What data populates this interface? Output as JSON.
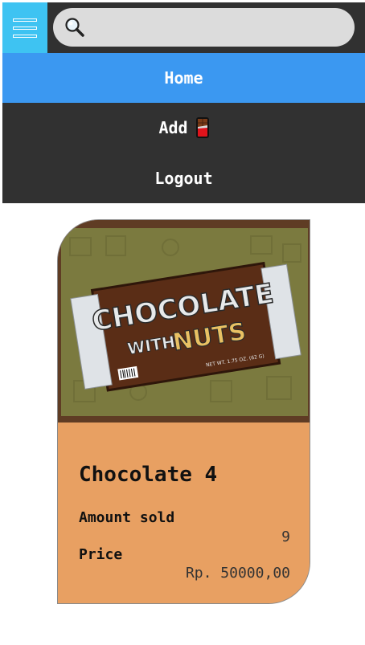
{
  "header": {
    "menu_icon": "hamburger-menu-icon",
    "search_icon": "magnifier-icon",
    "search_value": "",
    "search_placeholder": ""
  },
  "nav": {
    "items": [
      {
        "label": "Home",
        "active": true
      },
      {
        "label": "Add",
        "icon": "chocolate-bar-icon"
      },
      {
        "label": "Logout"
      }
    ]
  },
  "product": {
    "image_text_line1": "CHOCOLATE",
    "image_text_line2": "WITH",
    "image_text_line3": "NUTS",
    "image_small_text": "NET WT. 1.75 OZ. (62 G)",
    "name": "Chocolate 4",
    "amount_label": "Amount sold",
    "amount_value": "9",
    "price_label": "Price",
    "price_value": "Rp. 50000,00"
  },
  "colors": {
    "menu_bg": "#3ec3f2",
    "nav_bg": "#313131",
    "active_nav": "#3b98f1",
    "card_bg": "#e8a062"
  }
}
